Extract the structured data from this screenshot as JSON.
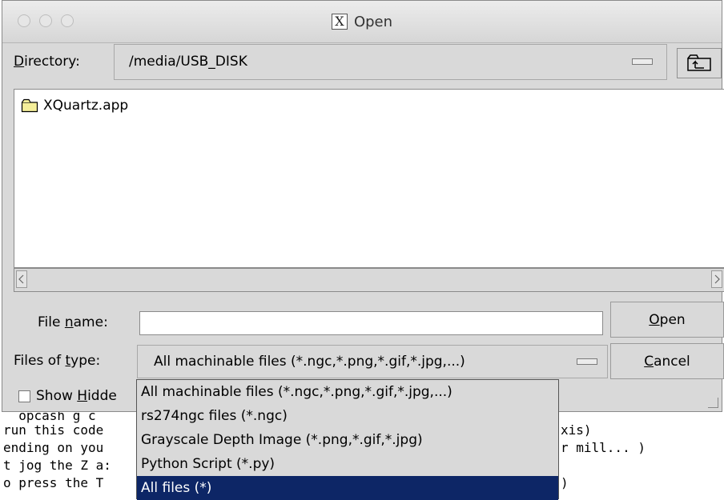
{
  "background_terminal": {
    "lines": [
      "  opcash g c",
      "run this code",
      "ending on you",
      "t jog the Z a:",
      "o press the T"
    ],
    "right_fragments": [
      "xis)",
      "r mill... )",
      ")"
    ]
  },
  "dialog": {
    "title": "Open",
    "directory": {
      "label_first": "D",
      "label_rest": "irectory:",
      "value": "/media/USB_DISK"
    },
    "files": [
      {
        "name": "XQuartz.app",
        "icon": "folder-icon"
      }
    ],
    "file_name": {
      "label_pre": "File ",
      "label_u": "n",
      "label_post": "ame:",
      "value": ""
    },
    "files_of_type": {
      "label_pre": "Files of ",
      "label_u": "t",
      "label_post": "ype:",
      "selected": "All machinable files (*.ngc,*.png,*.gif,*.jpg,...)"
    },
    "show_hidden": {
      "label_pre": "Show ",
      "label_u": "H",
      "label_post": "idde",
      "checked": false
    },
    "open_button": {
      "u": "O",
      "rest": "pen"
    },
    "cancel_button": {
      "u": "C",
      "rest": "ancel"
    }
  },
  "dropdown": {
    "options": [
      "All machinable files (*.ngc,*.png,*.gif,*.jpg,...)",
      "rs274ngc files (*.ngc)",
      "Grayscale Depth Image (*.png,*.gif,*.jpg)",
      "Python Script (*.py)",
      "All files (*)"
    ],
    "highlighted_index": 4
  },
  "colors": {
    "dialog_bg": "#d9d9d9",
    "highlight": "#0d2666",
    "folder_fill": "#f5ef9a"
  }
}
